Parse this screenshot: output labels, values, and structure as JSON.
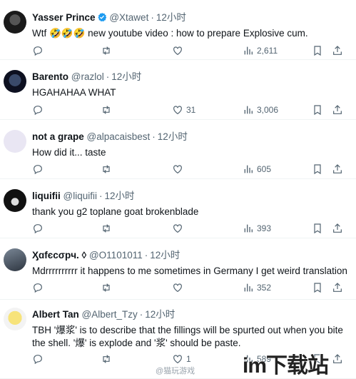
{
  "tweets": [
    {
      "name": "Yasser Prince",
      "verified": true,
      "handle": "@Xtawet",
      "time": "12小时",
      "text": "Wtf 🤣🤣🤣 new youtube video : how to prepare Explosive cum.",
      "replies": "",
      "retweets": "",
      "likes": "",
      "views": "2,611"
    },
    {
      "name": "Barento",
      "verified": false,
      "handle": "@razlol",
      "time": "12小时",
      "text": "HGAHAHAA WHAT",
      "replies": "",
      "retweets": "",
      "likes": "31",
      "views": "3,006"
    },
    {
      "name": "not a grape",
      "verified": false,
      "handle": "@alpacaisbest",
      "time": "12小时",
      "text": "How did it... taste",
      "replies": "",
      "retweets": "",
      "likes": "",
      "views": "605"
    },
    {
      "name": "liquifii",
      "verified": false,
      "handle": "@liquifii",
      "time": "12小时",
      "text": "thank you g2 toplane goat brokenblade",
      "replies": "",
      "retweets": "",
      "likes": "",
      "views": "393"
    },
    {
      "name": "Ӽɑfєcσpч. ◊",
      "verified": false,
      "handle": "@O1101011",
      "time": "12小时",
      "text": "Mdrrrrrrrrrr it happens to me sometimes in Germany I get weird translation",
      "replies": "",
      "retweets": "",
      "likes": "",
      "views": "352"
    },
    {
      "name": "Albert Tan",
      "verified": false,
      "handle": "@Albert_Tzy",
      "time": "12小时",
      "text": "TBH '爆浆' is to describe that the fillings will be spurted out when you bite the shell. '爆' is explode and '浆' should be paste.",
      "replies": "",
      "retweets": "",
      "likes": "1",
      "views": "589"
    }
  ],
  "watermarks": {
    "weibo": "@猫玩游戏",
    "site": "im下载站"
  },
  "colors": {
    "text": "#0f1419",
    "muted": "#536471",
    "verified": "#1d9bf0",
    "divider": "#eff3f4"
  }
}
